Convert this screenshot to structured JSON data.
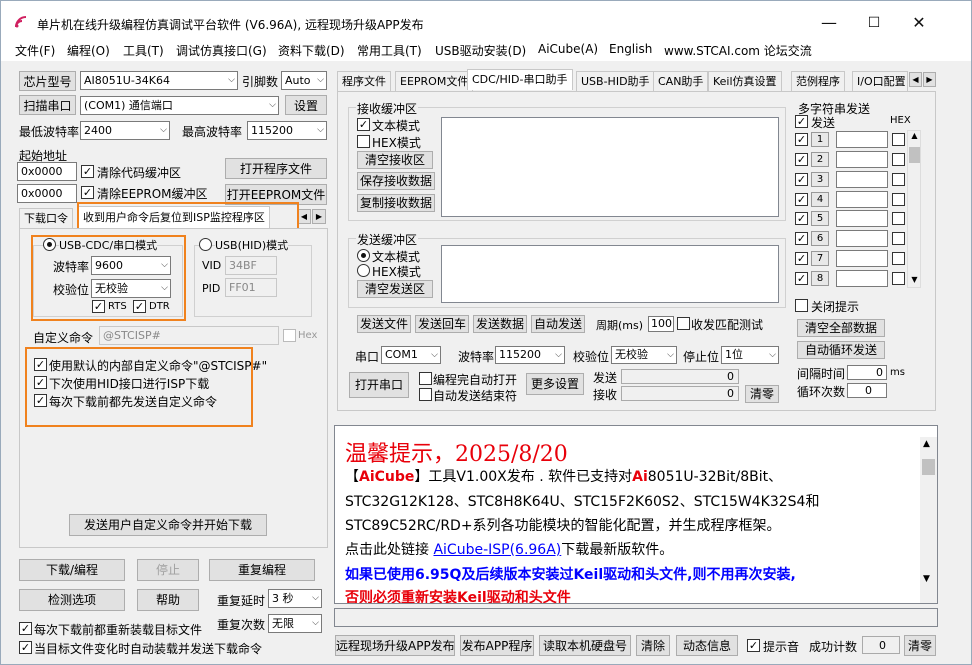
{
  "window": {
    "title": "单片机在线升级编程仿真调试平台软件 (V6.96A), 远程现场升级APP发布",
    "controls": [
      "—",
      "☐",
      "✕"
    ]
  },
  "menu": [
    "文件(F)",
    "编程(O)",
    "工具(T)",
    "调试仿真接口(G)",
    "资料下载(D)",
    "常用工具(T)",
    "USB驱动安装(D)",
    "AiCube(A)",
    "English",
    "www.STCAI.com 论坛交流"
  ],
  "left": {
    "chip_label": "芯片型号",
    "chip_value": "AI8051U-34K64",
    "pins_label": "引脚数",
    "pins_value": "Auto",
    "scan_port": "扫描串口",
    "port_value": "(COM1) 通信端口",
    "settings": "设置",
    "min_baud_label": "最低波特率",
    "min_baud": "2400",
    "max_baud_label": "最高波特率",
    "max_baud": "115200",
    "start_addr": "起始地址",
    "addr1": "0x0000",
    "clear_code": "清除代码缓冲区",
    "open_prog": "打开程序文件",
    "addr2": "0x0000",
    "clear_eeprom": "清除EEPROM缓冲区",
    "open_eeprom": "打开EEPROM文件",
    "tab_download": "下载口令",
    "tab_isp": "收到用户命令后复位到ISP监控程序区",
    "usb_cdc": "USB-CDC/串口模式",
    "usb_hid": "USB(HID)模式",
    "baud_label": "波特率",
    "baud_value": "9600",
    "parity_label": "校验位",
    "parity_value": "无校验",
    "rts": "RTS",
    "dtr": "DTR",
    "vid_label": "VID",
    "vid_value": "34BF",
    "pid_label": "PID",
    "pid_value": "FF01",
    "custom_cmd_label": "自定义命令",
    "custom_cmd_value": "@STCISP#",
    "hex": "Hex",
    "opt1": "使用默认的内部自定义命令\"@STCISP#\"",
    "opt2": "下次使用HID接口进行ISP下载",
    "opt3": "每次下载前都先发送自定义命令",
    "send_custom": "发送用户自定义命令并开始下载",
    "download": "下载/编程",
    "stop": "停止",
    "reprogram": "重复编程",
    "check": "检测选项",
    "help": "帮助",
    "repeat_delay_label": "重复延时",
    "repeat_delay": "3 秒",
    "repeat_count_label": "重复次数",
    "repeat_count": "无限",
    "reload1": "每次下载前都重新装载目标文件",
    "reload2": "当目标文件变化时自动装载并发送下载命令"
  },
  "tabs": [
    "程序文件",
    "EEPROM文件",
    "CDC/HID-串口助手",
    "USB-HID助手",
    "CAN助手",
    "Keil仿真设置",
    "范例程序",
    "I/O口配置"
  ],
  "serial": {
    "recv_group": "接收缓冲区",
    "text_mode": "文本模式",
    "hex_mode": "HEX模式",
    "clear_recv": "清空接收区",
    "save_recv": "保存接收数据",
    "copy_recv": "复制接收数据",
    "send_group": "发送缓冲区",
    "clear_send": "清空发送区",
    "send_file": "发送文件",
    "send_enter": "发送回车",
    "send_data": "发送数据",
    "auto_send": "自动发送",
    "period_label": "周期(ms)",
    "period_value": "100",
    "recv_match": "收发匹配测试",
    "port_label": "串口",
    "port_value": "COM1",
    "baud_label": "波特率",
    "baud_value": "115200",
    "parity_label": "校验位",
    "parity_value": "无校验",
    "stop_label": "停止位",
    "stop_value": "1位",
    "open_port": "打开串口",
    "auto_open": "编程完自动打开",
    "auto_close": "自动发送结束符",
    "more": "更多设置",
    "send_count_label": "发送",
    "send_count": "0",
    "recv_count_label": "接收",
    "recv_count": "0",
    "clear": "清零"
  },
  "multi": {
    "title": "多字符串发送",
    "send": "发送",
    "hex": "HEX",
    "rows": [
      "1",
      "2",
      "3",
      "4",
      "5",
      "6",
      "7",
      "8"
    ],
    "close_tip": "关闭提示",
    "clear_all": "清空全部数据",
    "auto_loop": "自动循环发送",
    "interval_label": "间隔时间",
    "interval_value": "0",
    "interval_unit": "ms",
    "loop_count_label": "循环次数",
    "loop_count": "0"
  },
  "notice": {
    "title": "温馨提示，2025/8/20",
    "l1a": "【",
    "l1b": "AiCube",
    "l1c": "】工具V1.00X发布 . 软件已支持对",
    "l1d": "Ai",
    "l1e": "8051U-32Bit/8Bit、",
    "l2": "STC32G12K128、STC8H8K64U、STC15F2K60S2、STC15W4K32S4和",
    "l3": "STC89C52RC/RD+系列各功能模块的智能化配置，并生成程序框架。",
    "l4a": "点击此处链接 ",
    "l4b": "AiCube-ISP(6.96A)",
    "l4c": "下载最新版软件。",
    "l5": "如果已使用6.95Q及后续版本安装过Keil驱动和头文件,则不用再次安装,",
    "l6": "否则必须重新安装Keil驱动和头文件"
  },
  "bottom": {
    "remote": "远程现场升级APP发布",
    "publish": "发布APP程序",
    "read_disk": "读取本机硬盘号",
    "clear": "清除",
    "dynamic": "动态信息",
    "beep": "提示音",
    "success_label": "成功计数",
    "success_count": "0",
    "reset": "清零"
  },
  "colors": {
    "accent_orange": "#f0821e",
    "notice_red": "#e8000a",
    "link_blue": "#0000ff"
  }
}
